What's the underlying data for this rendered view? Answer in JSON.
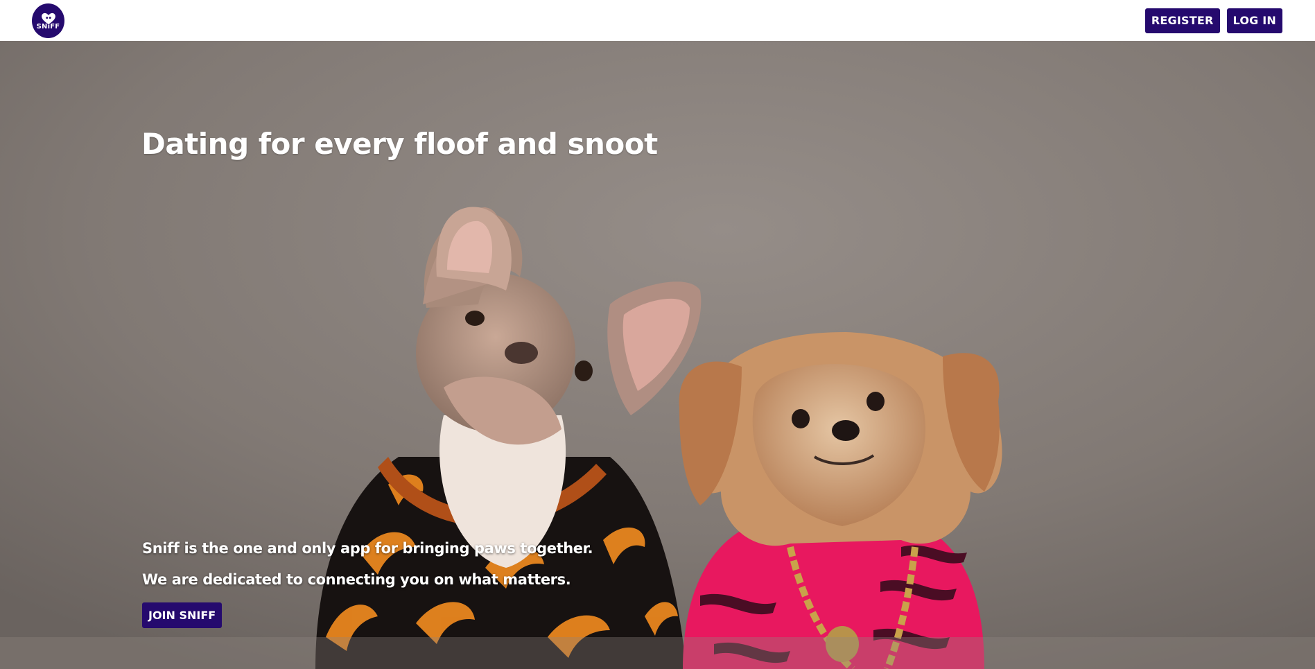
{
  "brand": {
    "name": "SNiFF",
    "logo_color": "#250a6e"
  },
  "nav": {
    "register_label": "REGISTER",
    "login_label": "LOG IN"
  },
  "hero": {
    "title": "Dating for every floof and snoot",
    "line1": "Sniff is the one and only app for bringing paws together.",
    "line2": "We are dedicated to connecting you on what matters.",
    "cta_label": "JOIN SNIFF",
    "photo_subject": "two dogs in patterned jackets"
  },
  "colors": {
    "accent": "#250a6e",
    "hero_text": "#ffffff"
  }
}
